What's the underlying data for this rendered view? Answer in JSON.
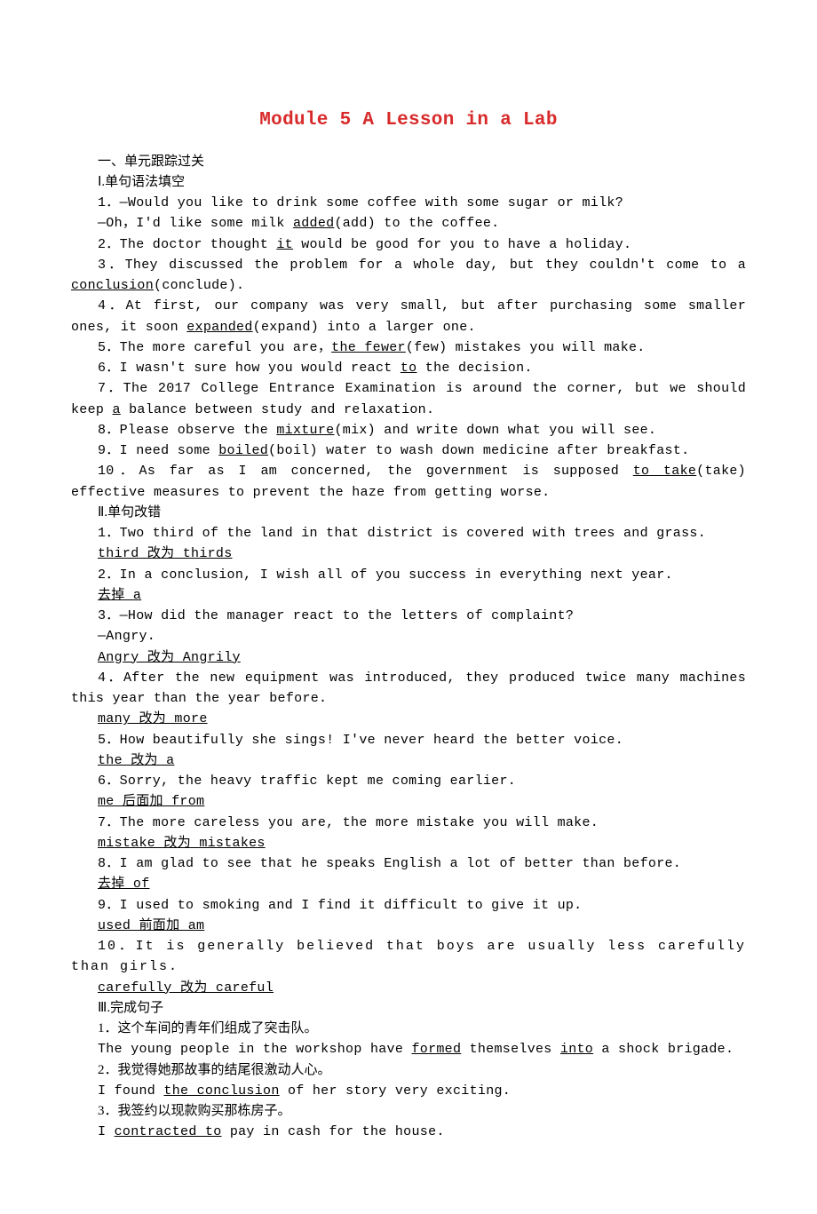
{
  "title": "Module 5  A Lesson in a Lab",
  "section1": {
    "heading": "一、单元跟踪过关",
    "sub1": "Ⅰ.单句语法填空",
    "q1a": "1．—Would you like to drink some coffee with some sugar or milk?",
    "q1b_pre": "—Oh，I'd like some milk ",
    "q1b_u": "added",
    "q1b_post": "(add) to the coffee.",
    "q2_pre": "2．The doctor thought ",
    "q2_u": "it",
    "q2_post": " would be good for you to have a holiday.",
    "q3_pre": "3．They discussed the problem for a whole day, but they couldn't come to a ",
    "q3_u": "conclusion",
    "q3_post": "(conclude).",
    "q4_pre": "4．At first, our company was very small, but after purchasing some smaller ones, it soon ",
    "q4_u": "expanded",
    "q4_post": "(expand) into a larger one.",
    "q5_pre": "5．The more careful you are，",
    "q5_u": "the fewer",
    "q5_post": "(few) mistakes you will make.",
    "q6_pre": "6．I wasn't sure how you would react ",
    "q6_u": "to",
    "q6_post": " the decision.",
    "q7_pre": "7．The 2017 College Entrance Examination is around the corner, but we should keep ",
    "q7_u": "a",
    "q7_post": " balance between study and relaxation.",
    "q8_pre": "8．Please observe the ",
    "q8_u": "mixture",
    "q8_post": "(mix) and write down what you will see.",
    "q9_pre": "9．I need some ",
    "q9_u": "boiled",
    "q9_post": "(boil)  water  to  wash  down medicine after breakfast.",
    "q10_pre": "10．As far as I am concerned, the government is supposed ",
    "q10_u": "to take",
    "q10_post": "(take) effective measures to prevent the haze from getting worse."
  },
  "section2": {
    "sub": "Ⅱ.单句改错",
    "q1": "1．Two third of the land in that district is covered with trees and grass.",
    "a1": "third 改为 thirds",
    "q2": "2．In a conclusion, I wish all of you success in everything next year.",
    "a2": "去掉 a",
    "q3a": "3．—How did the manager react to the letters of complaint?",
    "q3b": "—Angry.",
    "a3": "Angry 改为 Angrily",
    "q4": "4．After the new equipment was introduced, they produced twice many machines this year than the year before.",
    "a4": "many 改为 more",
    "q5": "5．How beautifully she sings! I've never heard the better voice.",
    "a5": "the 改为 a",
    "q6": "6．Sorry, the heavy traffic kept me coming earlier.",
    "a6": "me 后面加 from",
    "q7": "7．The more careless you are, the more mistake you will make.",
    "a7": "mistake 改为 mistakes",
    "q8": "8．I am glad to see that he speaks English a lot of better than before.",
    "a8": "去掉 of",
    "q9": "9．I used to smoking and I find it difficult to give it up.",
    "a9": "used 前面加 am",
    "q10": "10．It is generally believed that boys are usually less carefully than girls.",
    "a10": "carefully 改为 careful"
  },
  "section3": {
    "sub": "Ⅲ.完成句子",
    "q1c": "1．这个车间的青年们组成了突击队。",
    "q1e_pre": "The young people in the workshop have ",
    "q1e_u1": "formed",
    "q1e_mid": " themselves ",
    "q1e_u2": "into",
    "q1e_post": " a shock brigade.",
    "q2c": "2．我觉得她那故事的结尾很激动人心。",
    "q2e_pre": "I found ",
    "q2e_u": "the conclusion",
    "q2e_post": " of her story very exciting.",
    "q3c": "3．我签约以现款购买那栋房子。",
    "q3e_pre": "I ",
    "q3e_u": "contracted to",
    "q3e_post": " pay in cash for the house."
  }
}
